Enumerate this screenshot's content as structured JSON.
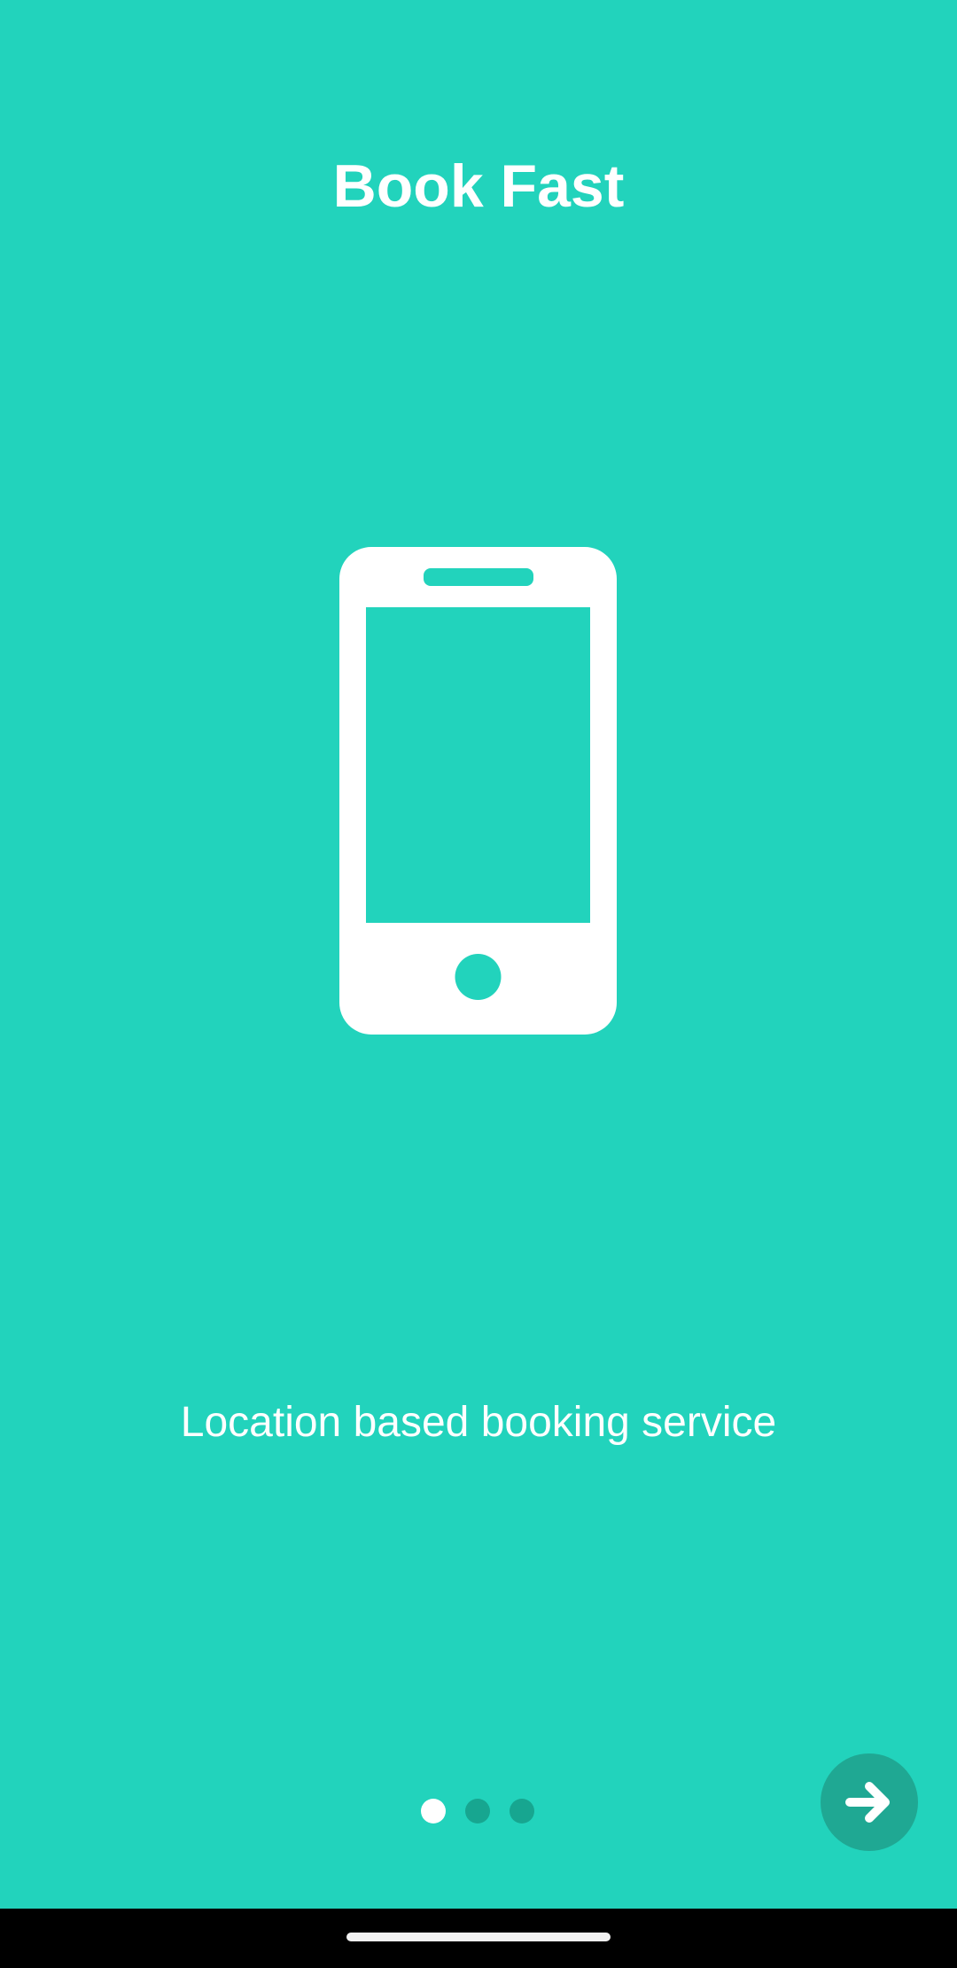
{
  "onboarding": {
    "title": "Book Fast",
    "subtitle": "Location based booking service",
    "illustration_icon": "smartphone-icon",
    "page_indicator": {
      "total": 3,
      "current": 1
    },
    "next_button_icon": "arrow-right-icon"
  },
  "colors": {
    "background": "#22d3bc",
    "foreground": "#ffffff",
    "accent_dark": "#1fa893",
    "inactive_dot": "#17a690",
    "nav_bar": "#000000"
  }
}
